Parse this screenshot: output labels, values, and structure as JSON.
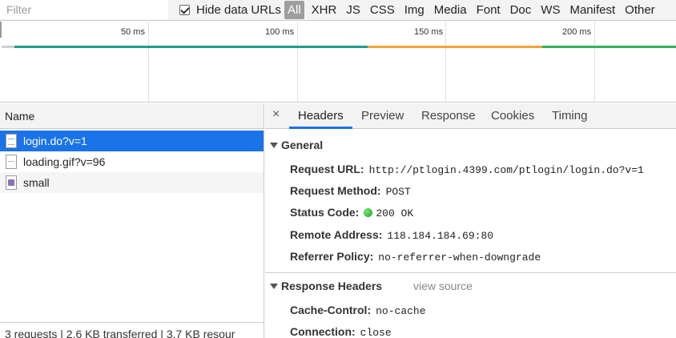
{
  "filter": {
    "placeholder": "Filter",
    "hide_data_urls_label": "Hide data URLs"
  },
  "resource_types": [
    "All",
    "XHR",
    "JS",
    "CSS",
    "Img",
    "Media",
    "Font",
    "Doc",
    "WS",
    "Manifest",
    "Other"
  ],
  "timeline": {
    "ticks": [
      "50 ms",
      "100 ms",
      "150 ms",
      "200 ms"
    ],
    "colors": {
      "teal": "#1e9f8a",
      "orange": "#f2a33a",
      "green": "#34b15a"
    }
  },
  "requests": {
    "header": "Name",
    "items": [
      {
        "name": "login.do?v=1",
        "icon": "document-icon"
      },
      {
        "name": "loading.gif?v=96",
        "icon": "gif-icon"
      },
      {
        "name": "small",
        "icon": "image-icon"
      }
    ],
    "summary": "3 requests | 2.6 KB transferred | 3.7 KB resour"
  },
  "detail_tabs": [
    "Headers",
    "Preview",
    "Response",
    "Cookies",
    "Timing"
  ],
  "close_glyph": "×",
  "general": {
    "title": "General",
    "rows": [
      {
        "key": "Request URL:",
        "value": "http://ptlogin.4399.com/ptlogin/login.do?v=1"
      },
      {
        "key": "Request Method:",
        "value": "POST"
      },
      {
        "key": "Status Code:",
        "value": "200 OK"
      },
      {
        "key": "Remote Address:",
        "value": "118.184.184.69:80"
      },
      {
        "key": "Referrer Policy:",
        "value": "no-referrer-when-downgrade"
      }
    ]
  },
  "response_headers": {
    "title": "Response Headers",
    "view_source": "view source",
    "rows": [
      {
        "key": "Cache-Control:",
        "value": "no-cache"
      },
      {
        "key": "Connection:",
        "value": "close"
      }
    ]
  },
  "accent_color": "#1a73e8"
}
